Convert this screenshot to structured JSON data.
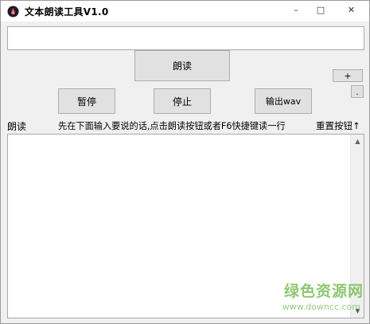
{
  "window": {
    "title": "文本朗读工具V1.0",
    "icon": "app-drop-icon",
    "controls": {
      "minimize": "–",
      "maximize": "□",
      "close": "✕"
    }
  },
  "top_input": {
    "value": "",
    "placeholder": ""
  },
  "buttons": {
    "read": "朗读",
    "pause": "暂停",
    "stop": "停止",
    "export": "输出wav",
    "plus": "+",
    "dot": "."
  },
  "labels": {
    "left": "朗读",
    "middle": "先在下面输入要说的话,点击朗读按钮或者F6快捷键读一行",
    "right": "重置按钮↑"
  },
  "main_text": {
    "value": ""
  },
  "scrollbar": {
    "up": "▲",
    "down": "▼"
  },
  "watermark": {
    "name": "绿色资源网",
    "url": "www.downcc.com"
  },
  "colors": {
    "background": "#f0f0f0",
    "watermark": "#7cbf5a"
  }
}
